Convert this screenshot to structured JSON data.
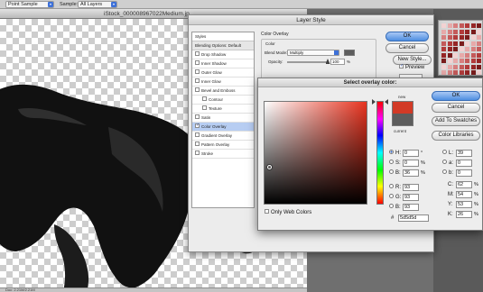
{
  "options_bar": {
    "sample_size_value": "Point Sample",
    "sample_label": "Sample:",
    "sample_value": "All Layers"
  },
  "document": {
    "title": "iStock_000008967022Medium.jp",
    "status": "Doc: 2.21M/2.21M"
  },
  "layer_style": {
    "title": "Layer Style",
    "styles_header": "Styles",
    "blending_options": "Blending Options: Default",
    "items": [
      {
        "label": "Drop Shadow",
        "checked": false,
        "sub": false,
        "selected": false
      },
      {
        "label": "Inner Shadow",
        "checked": false,
        "sub": false,
        "selected": false
      },
      {
        "label": "Outer Glow",
        "checked": false,
        "sub": false,
        "selected": false
      },
      {
        "label": "Inner Glow",
        "checked": false,
        "sub": false,
        "selected": false
      },
      {
        "label": "Bevel and Emboss",
        "checked": false,
        "sub": false,
        "selected": false
      },
      {
        "label": "Contour",
        "checked": false,
        "sub": true,
        "selected": false
      },
      {
        "label": "Texture",
        "checked": false,
        "sub": true,
        "selected": false
      },
      {
        "label": "Satin",
        "checked": false,
        "sub": false,
        "selected": false
      },
      {
        "label": "Color Overlay",
        "checked": true,
        "sub": false,
        "selected": true
      },
      {
        "label": "Gradient Overlay",
        "checked": false,
        "sub": false,
        "selected": false
      },
      {
        "label": "Pattern Overlay",
        "checked": false,
        "sub": false,
        "selected": false
      },
      {
        "label": "Stroke",
        "checked": false,
        "sub": false,
        "selected": false
      }
    ],
    "section_title": "Color Overlay",
    "group_title": "Color",
    "blend_mode_label": "Blend Mode:",
    "blend_mode_value": "Multiply",
    "opacity_label": "Opacity:",
    "opacity_value": "100",
    "opacity_unit": "%",
    "opacity_fraction": 1.0,
    "overlay_color": "#5d5d5d",
    "buttons": {
      "ok": "OK",
      "cancel": "Cancel",
      "new_style": "New Style..."
    },
    "preview_label": "Preview",
    "preview_checked": true
  },
  "color_picker": {
    "title": "Select overlay color:",
    "new_label": "new",
    "current_label": "current",
    "new_color": "#d23a26",
    "current_color": "#5d5d5d",
    "only_web_colors": "Only Web Colors",
    "buttons": {
      "ok": "OK",
      "cancel": "Cancel",
      "add_swatches": "Add To Swatches",
      "color_libraries": "Color Libraries"
    },
    "hsb": [
      {
        "label": "H:",
        "value": "0",
        "unit": "°",
        "selected": true
      },
      {
        "label": "S:",
        "value": "0",
        "unit": "%",
        "selected": false
      },
      {
        "label": "B:",
        "value": "36",
        "unit": "%",
        "selected": false
      }
    ],
    "rgb": [
      {
        "label": "R:",
        "value": "93"
      },
      {
        "label": "G:",
        "value": "93"
      },
      {
        "label": "B:",
        "value": "93"
      }
    ],
    "lab": [
      {
        "label": "L:",
        "value": "39"
      },
      {
        "label": "a:",
        "value": "0"
      },
      {
        "label": "b:",
        "value": "0"
      }
    ],
    "cmyk": [
      {
        "label": "C:",
        "value": "62",
        "unit": "%"
      },
      {
        "label": "M:",
        "value": "54",
        "unit": "%"
      },
      {
        "label": "Y:",
        "value": "53",
        "unit": "%"
      },
      {
        "label": "K:",
        "value": "26",
        "unit": "%"
      }
    ],
    "hex_label": "#",
    "hex_value": "5d5d5d"
  }
}
